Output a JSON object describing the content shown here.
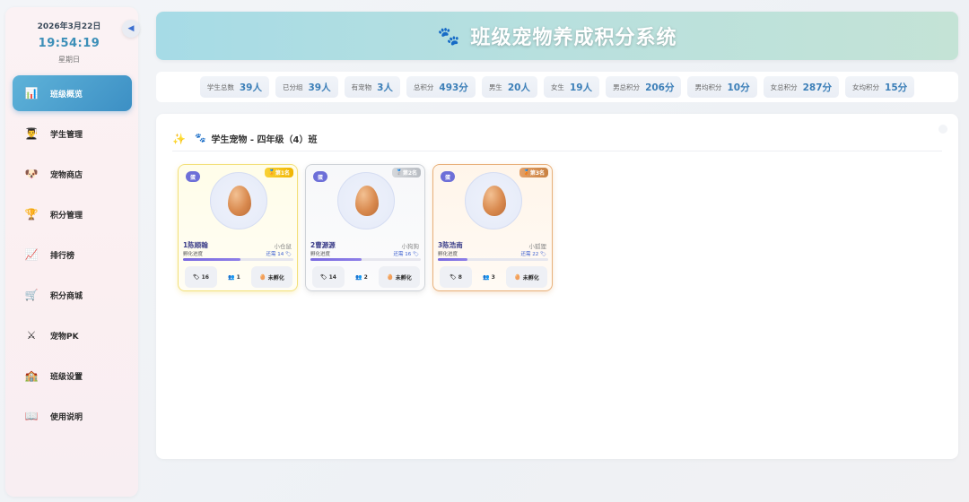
{
  "sidebar": {
    "date": "2026年3月22日",
    "time": "19:54:19",
    "weekday": "星期日",
    "items": [
      {
        "label": "班级概览",
        "icon": "📊"
      },
      {
        "label": "学生管理",
        "icon": "👨‍🎓"
      },
      {
        "label": "宠物商店",
        "icon": "🐶"
      },
      {
        "label": "积分管理",
        "icon": "🏆"
      },
      {
        "label": "排行榜",
        "icon": "📈"
      },
      {
        "label": "积分商城",
        "icon": "🛒"
      },
      {
        "label": "宠物PK",
        "icon": "⚔"
      },
      {
        "label": "班级设置",
        "icon": "🏫"
      },
      {
        "label": "使用说明",
        "icon": "📖"
      }
    ]
  },
  "header": {
    "title": "班级宠物养成积分系统",
    "icon": "🐾"
  },
  "stats": [
    {
      "label": "学生总数",
      "value": "39人"
    },
    {
      "label": "已分组",
      "value": "39人"
    },
    {
      "label": "有宠物",
      "value": "3人"
    },
    {
      "label": "总积分",
      "value": "493分"
    },
    {
      "label": "男生",
      "value": "20人"
    },
    {
      "label": "女生",
      "value": "19人"
    },
    {
      "label": "男总积分",
      "value": "206分"
    },
    {
      "label": "男均积分",
      "value": "10分"
    },
    {
      "label": "女总积分",
      "value": "287分"
    },
    {
      "label": "女均积分",
      "value": "15分"
    }
  ],
  "panel": {
    "title": "学生宠物 - 四年级（4）班"
  },
  "cards": [
    {
      "badge": "蛋",
      "rank": "第1名",
      "name": "1陈顺翰",
      "kind": "小仓鼠",
      "progress_label": "孵化进度",
      "need": "还需 14",
      "progress": 0.52,
      "points": "16",
      "group": "1",
      "status": "未孵化"
    },
    {
      "badge": "蛋",
      "rank": "第2名",
      "name": "2曹源源",
      "kind": "小狗狗",
      "progress_label": "孵化进度",
      "need": "还需 16",
      "progress": 0.46,
      "points": "14",
      "group": "2",
      "status": "未孵化"
    },
    {
      "badge": "蛋",
      "rank": "第3名",
      "name": "3陈浩南",
      "kind": "小狐狸",
      "progress_label": "孵化进度",
      "need": "还需 22",
      "progress": 0.27,
      "points": "8",
      "group": "3",
      "status": "未孵化"
    }
  ]
}
